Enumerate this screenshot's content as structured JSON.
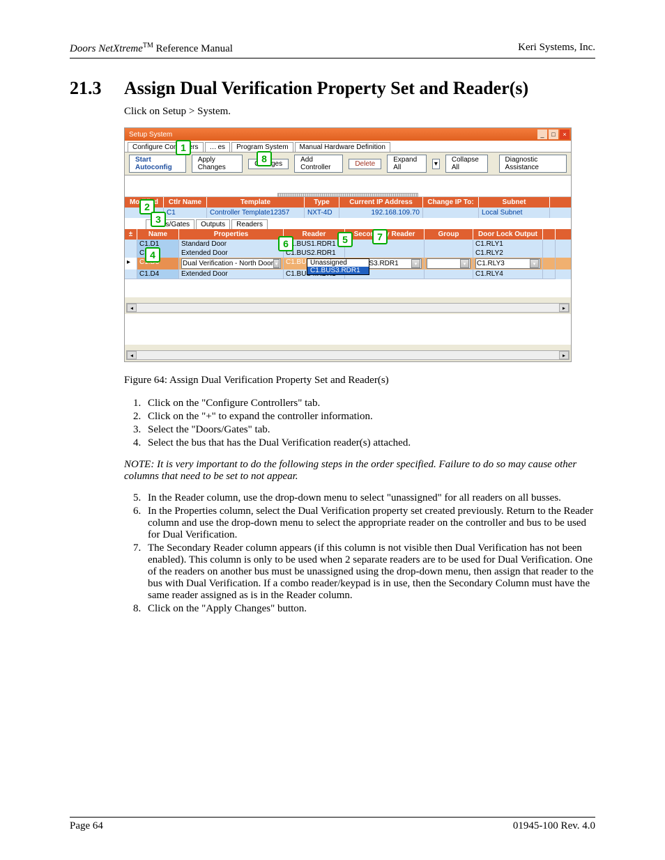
{
  "header": {
    "product": "Doors NetXtreme",
    "tm": "TM",
    "doc_type": "Reference Manual",
    "company": "Keri Systems, Inc."
  },
  "section": {
    "number": "21.3",
    "title": "Assign Dual Verification Property Set and Reader(s)"
  },
  "intro": "Click on Setup > System.",
  "screenshot": {
    "window_title": "Setup System",
    "top_tabs": [
      "Configure Controllers",
      "es",
      "Program System",
      "Manual Hardware Definition"
    ],
    "toolbar": {
      "start": "Start Autoconfig",
      "apply": "Apply Changes",
      "undo": "Changes",
      "add": "Add Controller",
      "delete": "Delete",
      "expand": "Expand All",
      "collapse": "Collapse All",
      "diag": "Diagnostic Assistance"
    },
    "main_cols": [
      "Modified",
      "Ctlr Name",
      "Template",
      "Type",
      "Current IP Address",
      "Change IP To:",
      "Subnet"
    ],
    "main_row": {
      "modified": "",
      "name": "C1",
      "template": "Controller Template12357",
      "type": "NXT-4D",
      "ip": "192.168.109.70",
      "change": "",
      "subnet": "Local Subnet"
    },
    "sub_tabs": [
      "Doors/Gates",
      "Outputs",
      "Readers"
    ],
    "sub_cols_left": "±",
    "sub_cols": [
      "Name",
      "Properties",
      "Reader",
      "Secondary Reader",
      "Group",
      "Door Lock Output"
    ],
    "rows": [
      {
        "name": "C1.D1",
        "props": "Standard Door",
        "reader": "C1.BUS1.RDR1",
        "sec": "",
        "group": "",
        "lock": "C1.RLY1"
      },
      {
        "name": "C1.D2",
        "props": "Extended Door",
        "reader": "C1.BUS2.RDR1",
        "sec": "",
        "group": "",
        "lock": "C1.RLY2"
      },
      {
        "name": "C1.D3",
        "props": "Dual Verification - North Door",
        "reader": "C1.BUS3.RDR1",
        "sec": "C1.BUS3.RDR1",
        "group": "",
        "lock": "C1.RLY3"
      },
      {
        "name": "C1.D4",
        "props": "Extended Door",
        "reader": "C1.BUS4.RDR1",
        "sec": "",
        "group": "",
        "lock": "C1.RLY4"
      }
    ],
    "dropdown_options": [
      "Unassigned",
      "C1.BUS3.RDR1"
    ]
  },
  "caption": "Figure 64: Assign Dual Verification Property Set and Reader(s)",
  "steps_a": [
    "Click on the \"Configure Controllers\" tab.",
    "Click on the \"+\" to expand the controller information.",
    "Select the \"Doors/Gates\" tab.",
    "Select the bus that has the Dual Verification reader(s) attached."
  ],
  "note": "NOTE: It is very important to do the following steps in the order specified. Failure to do so may cause other columns that need to be set to not appear.",
  "steps_b": [
    "In the Reader column, use the drop-down menu to select \"unassigned\" for all readers on all busses.",
    "In the Properties column, select the Dual Verification property set created previously. Return to the Reader column and use the drop-down menu to select the appropriate reader on the controller and bus to be used for Dual Verification.",
    "The Secondary Reader column appears (if this column is not visible then Dual Verification has not been enabled). This column is only to be used when 2 separate readers are to be used for Dual Verification. One of the readers on another bus must be unassigned using the drop-down menu, then assign that reader to the bus with Dual Verification. If a combo reader/keypad is in use, then the Secondary Column must have the same reader assigned as is in the Reader column.",
    "Click on the \"Apply Changes\" button."
  ],
  "callouts": {
    "c1": "1",
    "c2": "2",
    "c3": "3",
    "c4": "4",
    "c5": "5",
    "c6": "6",
    "c7": "7",
    "c8": "8"
  },
  "footer": {
    "page": "Page 64",
    "rev": "01945-100  Rev. 4.0"
  }
}
